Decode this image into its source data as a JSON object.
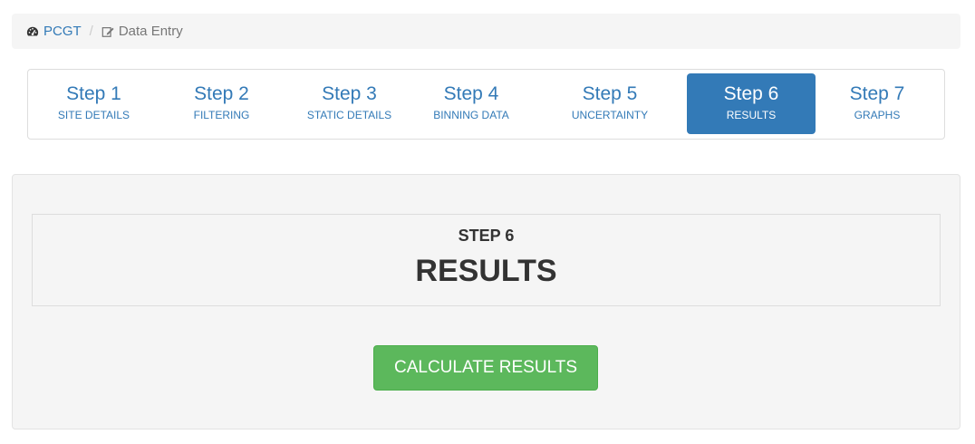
{
  "breadcrumb": {
    "home_label": "PCGT",
    "home_icon": "dashboard-icon",
    "separator": "/",
    "current_label": "Data Entry",
    "current_icon": "edit-icon"
  },
  "wizard": {
    "steps": [
      {
        "number": "Step 1",
        "label": "SITE DETAILS",
        "active": false
      },
      {
        "number": "Step 2",
        "label": "FILTERING",
        "active": false
      },
      {
        "number": "Step 3",
        "label": "STATIC DETAILS",
        "active": false
      },
      {
        "number": "Step 4",
        "label": "BINNING DATA",
        "active": false
      },
      {
        "number": "Step 5",
        "label": "UNCERTAINTY",
        "active": false
      },
      {
        "number": "Step 6",
        "label": "RESULTS",
        "active": true
      },
      {
        "number": "Step 7",
        "label": "GRAPHS",
        "active": false
      }
    ]
  },
  "main": {
    "step_label": "STEP 6",
    "title": "RESULTS",
    "calculate_button": "CALCULATE RESULTS"
  },
  "colors": {
    "primary": "#337ab7",
    "success": "#5cb85c"
  }
}
